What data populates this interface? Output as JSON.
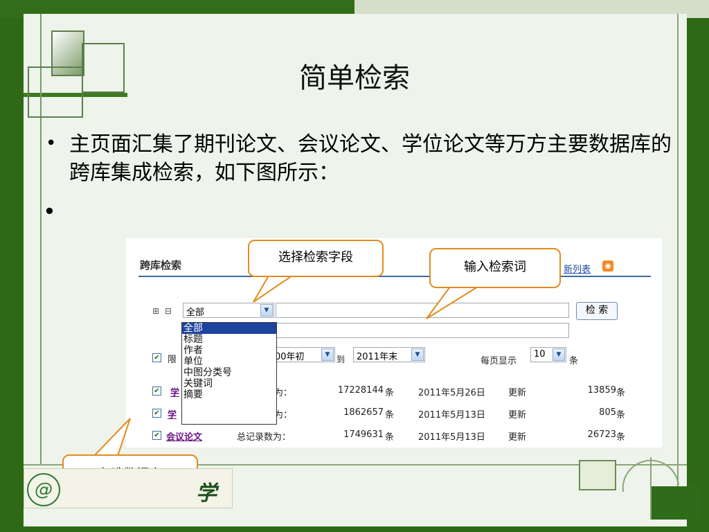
{
  "slide": {
    "title": "简单检索",
    "bullet1": "主页面汇集了期刊论文、会议论文、学位论文等万方主要数据库的跨库集成检索，如下图所示：",
    "bullet_marker": "•"
  },
  "panel": {
    "heading": "跨库检索",
    "rss_link_partial": "新列表",
    "expand_icon": "⊞",
    "collapse_icon": "⊟",
    "field_select_value": "全部",
    "search_button": "检 索",
    "year_limit_label_partial": "限",
    "year_from_partial": "00年初",
    "year_to_word": "到",
    "year_to_value": "2011年末",
    "per_page_label": "每页显示",
    "per_page_value": "10",
    "per_page_unit": "条"
  },
  "field_options": [
    "全部",
    "标题",
    "作者",
    "单位",
    "中图分类号",
    "关键词",
    "摘要"
  ],
  "databases": [
    {
      "name_partial": "学",
      "label_partial": "为：",
      "total": "17228144",
      "unit": "条",
      "date": "2011年5月26日",
      "update_label": "更新",
      "new_count": "13859",
      "new_unit": "条"
    },
    {
      "name_partial": "学",
      "label_partial": "为：",
      "total": "1862657",
      "unit": "条",
      "date": "2011年5月13日",
      "update_label": "更新",
      "new_count": "805",
      "new_unit": "条"
    },
    {
      "name": "会议论文",
      "label": "总记录数为：",
      "total": "1749631",
      "unit": "条",
      "date": "2011年5月13日",
      "update_label": "更新",
      "new_count": "26723",
      "new_unit": "条"
    }
  ],
  "callouts": {
    "select_field": "选择检索字段",
    "input_term": "输入检索词",
    "check_database": "勾选数据库"
  },
  "logo_partial_text": "学",
  "colors": {
    "green_band": "#346d1a",
    "slide_bg": "#eef3ec",
    "callout_border": "#e38a1a",
    "dropdown_highlight": "#1e44a0",
    "db_link": "#6a1585"
  }
}
